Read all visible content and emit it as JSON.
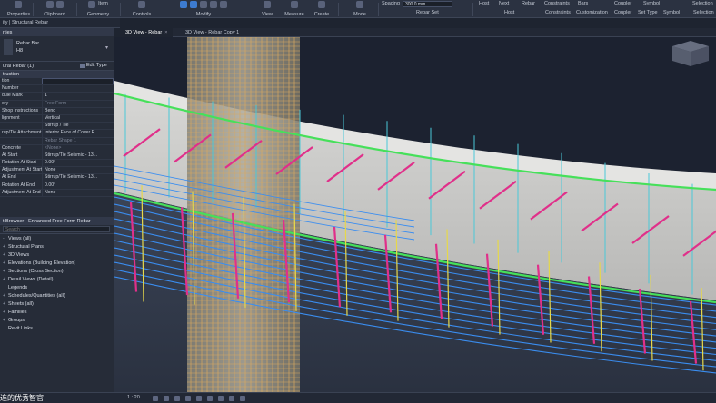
{
  "ribbon": {
    "groups": [
      {
        "label": "Properties"
      },
      {
        "label": "Clipboard"
      },
      {
        "label": "Geometry"
      },
      {
        "label": "Controls"
      },
      {
        "label": "Modify"
      },
      {
        "label": "View"
      },
      {
        "label": "Measure"
      },
      {
        "label": "Create"
      },
      {
        "label": "Mode"
      }
    ],
    "item_label": "Item",
    "spacing_label": "Spacing",
    "spacing_value": "300.0 mm",
    "rebar_set_label": "Rebar Set",
    "host_label": "Host",
    "next_label": "Next",
    "rebar_label": "Rebar",
    "constraints_label": "Constraints",
    "bars_label": "Bars",
    "coupler_label": "Coupler",
    "symbol_label": "Symbol",
    "selection_label": "Selection",
    "right_groups": [
      "Host",
      "Constraints",
      "Customization",
      "Coupler",
      "Set Type",
      "Symbol",
      "Selection"
    ]
  },
  "breadcrumb": "ify | Structural Rebar",
  "properties": {
    "title": "rties",
    "type_name": "Rebar Bar",
    "type_sub": "H8",
    "instance_label": "ural Rebar (1)",
    "edit_type_label": "Edit Type",
    "section_label": "truction",
    "rows": [
      {
        "k": "tion",
        "v": "",
        "style": "box"
      },
      {
        "k": "Number",
        "v": "",
        "style": "dim"
      },
      {
        "k": "dule Mark",
        "v": "1",
        "style": ""
      },
      {
        "k": "ory",
        "v": "Free Form",
        "style": "dim"
      },
      {
        "k": "Shop Instructions",
        "v": "Bend",
        "style": ""
      },
      {
        "k": "lignment",
        "v": "Vertical",
        "style": ""
      },
      {
        "k": "",
        "v": "Stirrup / Tie",
        "style": ""
      },
      {
        "k": "rup/Tie Attachment",
        "v": "Interior Face of Cover R...",
        "style": ""
      },
      {
        "k": "",
        "v": "Rebar Shape 1",
        "style": "dim"
      },
      {
        "k": "Concrete",
        "v": "<None>",
        "style": "dim"
      },
      {
        "k": "At Start",
        "v": "Stirrup/Tie Seismic - 13...",
        "style": ""
      },
      {
        "k": "Rotation At Start",
        "v": "0.00°",
        "style": ""
      },
      {
        "k": "Adjustment At Start",
        "v": "None",
        "style": ""
      },
      {
        "k": "At End",
        "v": "Stirrup/Tie Seismic - 13...",
        "style": ""
      },
      {
        "k": "Rotation At End",
        "v": "0.00°",
        "style": ""
      },
      {
        "k": "Adjustment At End",
        "v": "None",
        "style": ""
      }
    ]
  },
  "browser": {
    "title": "t Browser - Enhanced Free Form Rebar",
    "search_placeholder": "Search",
    "items": [
      {
        "label": "Views (all)",
        "toggle": "-"
      },
      {
        "label": "Structural Plans",
        "toggle": "+"
      },
      {
        "label": "3D Views",
        "toggle": "+"
      },
      {
        "label": "Elevations (Building Elevation)",
        "toggle": "+"
      },
      {
        "label": "Sections (Cross Section)",
        "toggle": "+"
      },
      {
        "label": "Detail Views (Detail)",
        "toggle": "+"
      },
      {
        "label": "Legends",
        "toggle": ""
      },
      {
        "label": "Schedules/Quantities (all)",
        "toggle": "+"
      },
      {
        "label": "Sheets (all)",
        "toggle": "+"
      },
      {
        "label": "Families",
        "toggle": "+"
      },
      {
        "label": "Groups",
        "toggle": "+"
      },
      {
        "label": "Revit Links",
        "toggle": ""
      }
    ]
  },
  "tabs": [
    {
      "label": "3D View - Rebar",
      "active": true
    },
    {
      "label": "3D View - Rebar Copy 1",
      "active": false
    }
  ],
  "status": {
    "scale": "1 : 20"
  },
  "caption": "连的优秀智官",
  "colors": {
    "stirrup_blue": "#3a8df0",
    "stirrup_magenta": "#e0308a",
    "stirrup_yellow": "#e6d84a",
    "longitudinal_green": "#46e05a",
    "vertical_cyan": "#4ac8d8",
    "column_orange": "#d8a860",
    "concrete_grey": "#c8c8c6"
  }
}
